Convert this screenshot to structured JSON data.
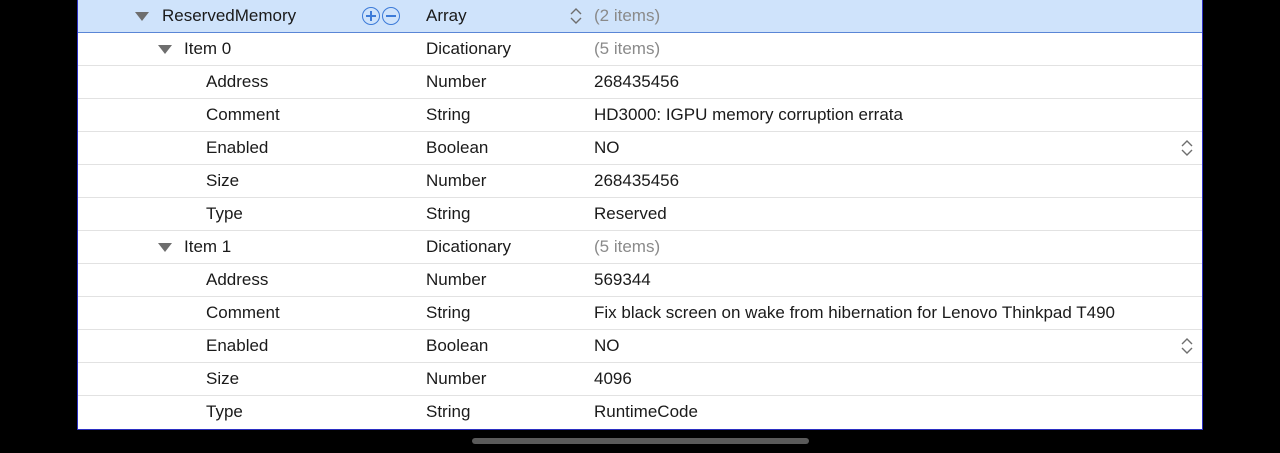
{
  "rows": [
    {
      "key": "ReservedMemory",
      "type": "Array",
      "value": "(2 items)"
    },
    {
      "key": "Item 0",
      "type": "Dicationary",
      "value": "(5 items)"
    },
    {
      "key": "Address",
      "type": "Number",
      "value": "268435456"
    },
    {
      "key": "Comment",
      "type": "String",
      "value": "HD3000: IGPU memory corruption errata"
    },
    {
      "key": "Enabled",
      "type": "Boolean",
      "value": "NO"
    },
    {
      "key": "Size",
      "type": "Number",
      "value": "268435456"
    },
    {
      "key": "Type",
      "type": "String",
      "value": "Reserved"
    },
    {
      "key": "Item 1",
      "type": "Dicationary",
      "value": "(5 items)"
    },
    {
      "key": "Address",
      "type": "Number",
      "value": "569344"
    },
    {
      "key": "Comment",
      "type": "String",
      "value": "Fix black screen on wake from hibernation for Lenovo Thinkpad T490"
    },
    {
      "key": "Enabled",
      "type": "Boolean",
      "value": "NO"
    },
    {
      "key": "Size",
      "type": "Number",
      "value": "4096"
    },
    {
      "key": "Type",
      "type": "String",
      "value": "RuntimeCode"
    }
  ],
  "icons": {
    "disclosure": "disclosure-triangle-icon",
    "add": "plus-circle-icon",
    "remove": "minus-circle-icon",
    "stepper": "up-down-stepper-icon"
  },
  "colors": {
    "selection": "#cfe3fb",
    "accent": "#3d7bd8",
    "frame": "#2b2fc2",
    "muted_text": "#8a8a8a"
  }
}
